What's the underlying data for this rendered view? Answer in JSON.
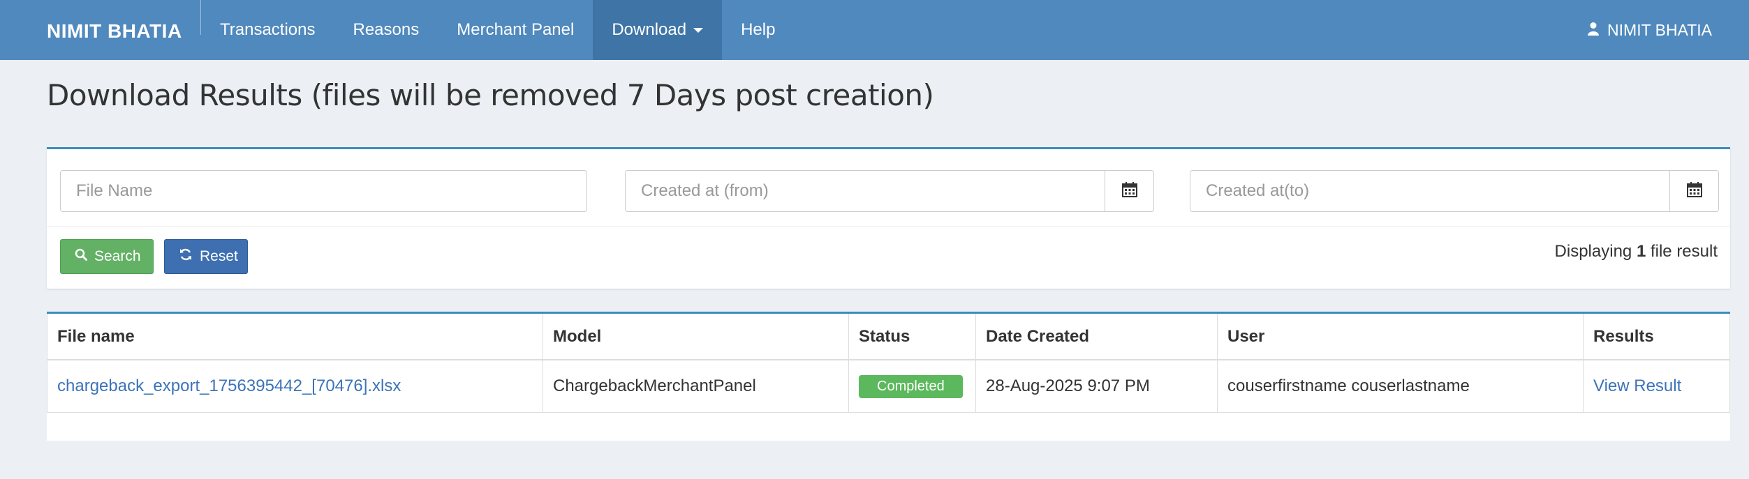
{
  "navbar": {
    "brand": "NIMIT BHATIA",
    "items": [
      {
        "label": "Transactions"
      },
      {
        "label": "Reasons"
      },
      {
        "label": "Merchant Panel"
      },
      {
        "label": "Download"
      },
      {
        "label": "Help"
      }
    ],
    "user": "NIMIT BHATIA"
  },
  "page": {
    "title": "Download Results (files will be removed 7 Days post creation)"
  },
  "filters": {
    "file_name_placeholder": "File Name",
    "created_from_placeholder": "Created at (from)",
    "created_to_placeholder": "Created at(to)",
    "search_label": "Search",
    "reset_label": "Reset",
    "count_prefix": "Displaying ",
    "count_value": "1",
    "count_suffix": " file result"
  },
  "table": {
    "headers": [
      "File name",
      "Model",
      "Status",
      "Date Created",
      "User",
      "Results"
    ],
    "rows": [
      {
        "file_name": "chargeback_export_1756395442_[70476].xlsx",
        "model": "ChargebackMerchantPanel",
        "status": "Completed",
        "date_created": "28-Aug-2025 9:07 PM",
        "user": "couserfirstname couserlastname",
        "results": "View Result"
      }
    ]
  },
  "colors": {
    "navbar": "#5089bd",
    "navbar_active": "#3f75a6",
    "success": "#5cb85c",
    "primary": "#3d6fb1",
    "link": "#3c73b8"
  }
}
